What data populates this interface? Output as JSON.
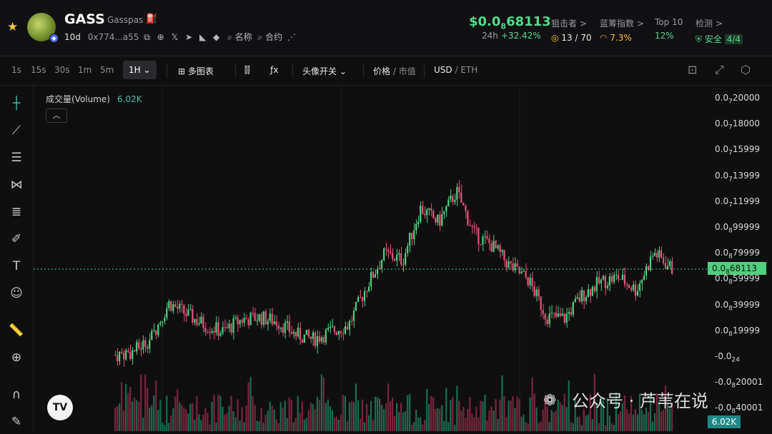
{
  "header": {
    "token_symbol": "GASS",
    "token_name": "Gasspas",
    "age": "10d",
    "contract": "0x774...a55",
    "link_name": "名称",
    "link_contract": "合约",
    "price_prefix": "$0.0",
    "price_sub": "8",
    "price_suffix": "68113",
    "change_label": "24h",
    "change_pct": "+32.42%",
    "stats": [
      {
        "label": "狙击者 >",
        "value": "13 / 70",
        "color": "#e8e8e8"
      },
      {
        "label": "蓝筹指数 >",
        "value": "7.3%",
        "color": "#f5c542"
      },
      {
        "label": "Top 10",
        "value": "12%",
        "color": "#58d68d"
      },
      {
        "label": "检测 >",
        "value": "安全",
        "extra": "4/4",
        "color": "#58d68d"
      }
    ]
  },
  "toolbar": {
    "intervals": [
      "1s",
      "15s",
      "30s",
      "1m",
      "5m"
    ],
    "active_interval": "1H",
    "multi_chart": "多图表",
    "head_toggle": "头像开关",
    "price": "价格",
    "market_cap": "市值",
    "usd": "USD",
    "eth": "ETH"
  },
  "legend": {
    "label": "成交量(Volume)",
    "value": "6.02K"
  },
  "axis": {
    "labels": [
      {
        "pre": "0.0",
        "sub": "7",
        "post": "20000"
      },
      {
        "pre": "0.0",
        "sub": "7",
        "post": "18000"
      },
      {
        "pre": "0.0",
        "sub": "7",
        "post": "15999"
      },
      {
        "pre": "0.0",
        "sub": "7",
        "post": "13999"
      },
      {
        "pre": "0.0",
        "sub": "7",
        "post": "11999"
      },
      {
        "pre": "0.0",
        "sub": "8",
        "post": "99999"
      },
      {
        "pre": "0.0",
        "sub": "8",
        "post": "79999"
      },
      {
        "pre": "0.0",
        "sub": "8",
        "post": "59999"
      },
      {
        "pre": "0.0",
        "sub": "8",
        "post": "39999"
      },
      {
        "pre": "0.0",
        "sub": "8",
        "post": "19999"
      },
      {
        "pre": "-0.0",
        "sub": "24",
        "post": ""
      },
      {
        "pre": "-0.0",
        "sub": "8",
        "post": "20001"
      },
      {
        "pre": "-0.0",
        "sub": "8",
        "post": "40001"
      }
    ],
    "current_price": {
      "pre": "0.0",
      "sub": "8",
      "post": "68113"
    },
    "current_volume": "6.02K"
  },
  "watermark": "公众号 · 芦苇在说",
  "icons": {
    "sidebar": [
      "crosshair-icon",
      "trendline-icon",
      "horizontal-lines-icon",
      "pattern-icon",
      "fib-icon",
      "brush-icon",
      "text-icon",
      "emoji-icon",
      "ruler-icon",
      "zoom-icon",
      "magnet-icon",
      "lock-pencil-icon"
    ],
    "toolbar_right": [
      "camera-icon",
      "fullscreen-icon",
      "settings-icon"
    ]
  },
  "chart_data": {
    "type": "candlestick",
    "interval": "1H",
    "series": [
      {
        "name": "price",
        "values": [
          2e-09,
          4.5e-09,
          1.5e-08,
          4.2e-08,
          3.3e-08,
          2.5e-08,
          2e-08,
          2.9e-08,
          3.1e-08,
          2.8e-08,
          1.8e-08,
          1.4e-08,
          2e-08,
          2.5e-08,
          5.5e-08,
          8e-08,
          7.5e-08,
          1.15e-07,
          1.04e-07,
          1.28e-07,
          9.5e-08,
          8.6e-08,
          7e-08,
          6e-08,
          3.2e-08,
          3e-08,
          4.8e-08,
          5.8e-08,
          6.2e-08,
          5.2e-08,
          8.1e-08,
          6.81e-08
        ]
      }
    ],
    "volume_last": "6.02K",
    "ylim": [
      "-0.0₈40001",
      "0.0₇20000"
    ],
    "current_price": "0.0₈68113"
  }
}
